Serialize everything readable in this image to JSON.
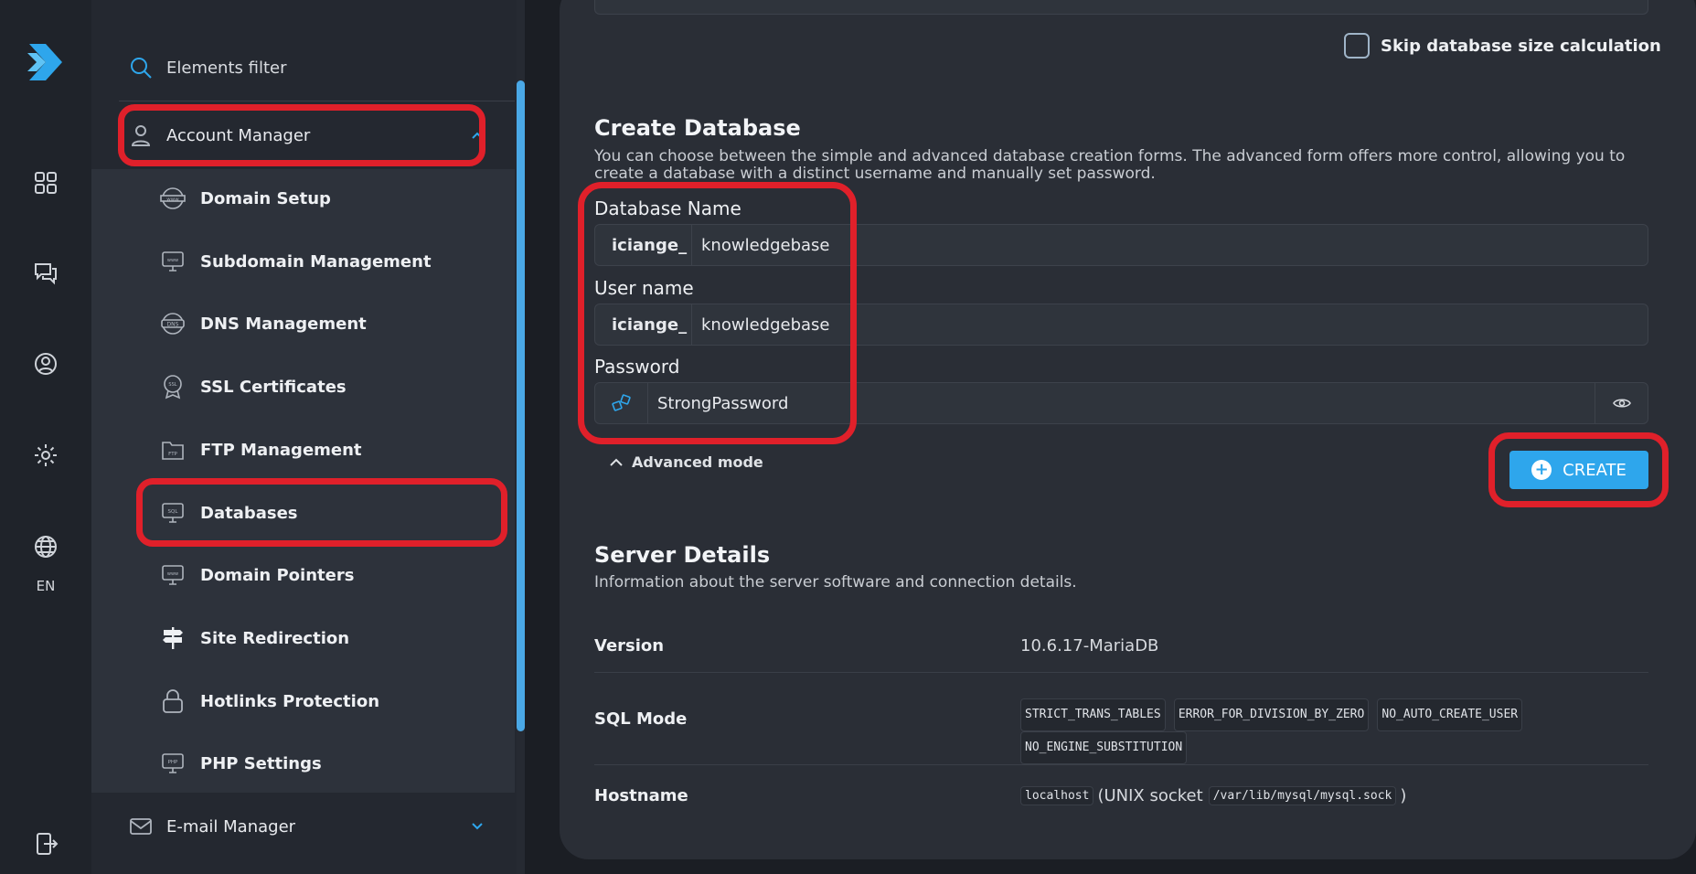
{
  "rail": {
    "language": "EN",
    "icons": [
      "logo-icon",
      "dashboard-icon",
      "support-chat-icon",
      "profile-icon",
      "settings-icon",
      "globe-icon",
      "logout-icon"
    ]
  },
  "sidebar": {
    "filter_label": "Elements filter",
    "group": {
      "label": "Account Manager",
      "icon": "user-icon"
    },
    "items": [
      {
        "label": "Domain Setup",
        "icon": "www-globe-icon"
      },
      {
        "label": "Subdomain Management",
        "icon": "subdomain-monitor-icon"
      },
      {
        "label": "DNS Management",
        "icon": "dns-icon"
      },
      {
        "label": "SSL Certificates",
        "icon": "ssl-badge-icon"
      },
      {
        "label": "FTP Management",
        "icon": "ftp-folder-icon"
      },
      {
        "label": "Databases",
        "icon": "sql-monitor-icon"
      },
      {
        "label": "Domain Pointers",
        "icon": "domain-pointer-icon"
      },
      {
        "label": "Site Redirection",
        "icon": "signpost-icon"
      },
      {
        "label": "Hotlinks Protection",
        "icon": "lock-icon"
      },
      {
        "label": "PHP Settings",
        "icon": "php-monitor-icon"
      }
    ],
    "email_group": {
      "label": "E-mail Manager",
      "icon": "mail-icon"
    }
  },
  "main": {
    "skip_label": "Skip database size calculation",
    "create_db": {
      "title": "Create Database",
      "description": "You can choose between the simple and advanced database creation forms. The advanced form offers more control, allowing you to create a database with a distinct username and manually set password.",
      "db_name_label": "Database Name",
      "db_prefix": "iciange_",
      "db_name_value": "knowledgebase",
      "user_label": "User name",
      "user_prefix": "iciange_",
      "user_value": "knowledgebase",
      "password_label": "Password",
      "password_value": "StrongPassword",
      "advanced_label": "Advanced mode",
      "create_label": "CREATE"
    },
    "server": {
      "title": "Server Details",
      "description": "Information about the server software and connection details.",
      "version_label": "Version",
      "version_value": "10.6.17-MariaDB",
      "sqlmode_label": "SQL Mode",
      "sql_modes": [
        "STRICT_TRANS_TABLES",
        "ERROR_FOR_DIVISION_BY_ZERO",
        "NO_AUTO_CREATE_USER",
        "NO_ENGINE_SUBSTITUTION"
      ],
      "hostname_label": "Hostname",
      "host_value": "localhost",
      "host_socket_prefix": "(UNIX socket",
      "host_socket_path": "/var/lib/mysql/mysql.sock",
      "host_socket_suffix": ")"
    }
  },
  "colors": {
    "accent": "#2ea6ec",
    "highlight": "#e0202a"
  }
}
